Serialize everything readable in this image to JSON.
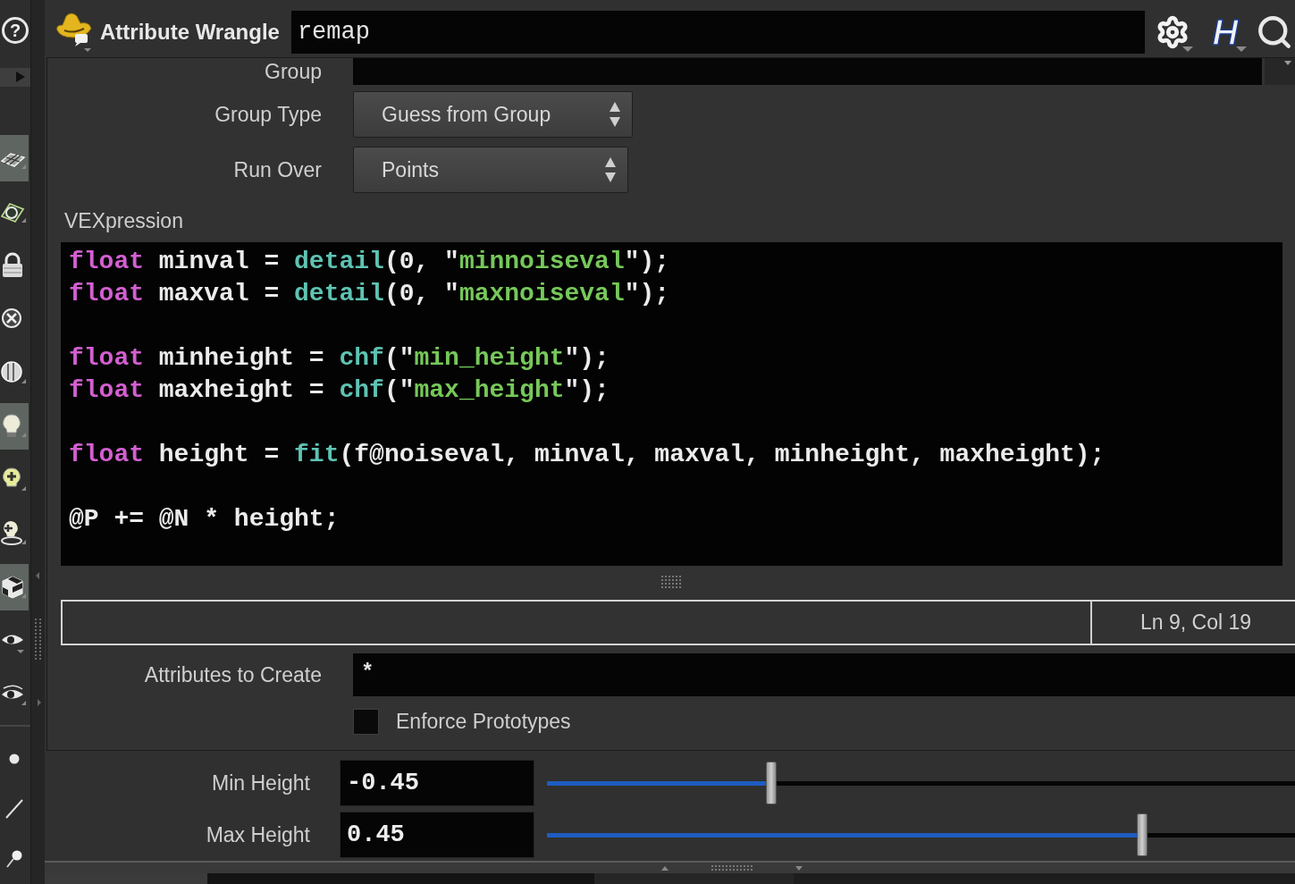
{
  "toolbar": {
    "help": "?",
    "tools": [
      {
        "on": true
      },
      {
        "on": false
      },
      {
        "on": false
      },
      {
        "on": false
      },
      {
        "on": false
      },
      {
        "on": true
      },
      {
        "on": false
      },
      {
        "on": false
      },
      {
        "on": true
      },
      {
        "on": false
      },
      {
        "on": false
      },
      {
        "on": false
      },
      {
        "on": false
      },
      {
        "on": false
      }
    ]
  },
  "header": {
    "node_type": "Attribute Wrangle",
    "node_name": "remap",
    "help_menu": "H"
  },
  "parameters": {
    "group": {
      "label": "Group"
    },
    "group_type": {
      "label": "Group Type",
      "value": "Guess from Group"
    },
    "run_over": {
      "label": "Run Over",
      "value": "Points"
    },
    "vexpression": {
      "label": "VEXpression",
      "lines": [
        {
          "kind": "code",
          "tokens": [
            {
              "kind": "keyword",
              "text": "float"
            },
            {
              "kind": "plain",
              "text": " minval = "
            },
            {
              "kind": "function",
              "text": "detail"
            },
            {
              "kind": "plain",
              "text": "(0, \""
            },
            {
              "kind": "string",
              "text": "minnoiseval"
            },
            {
              "kind": "plain",
              "text": "\");"
            }
          ]
        },
        {
          "kind": "code",
          "tokens": [
            {
              "kind": "keyword",
              "text": "float"
            },
            {
              "kind": "plain",
              "text": " maxval = "
            },
            {
              "kind": "function",
              "text": "detail"
            },
            {
              "kind": "plain",
              "text": "(0, \""
            },
            {
              "kind": "string",
              "text": "maxnoiseval"
            },
            {
              "kind": "plain",
              "text": "\");"
            }
          ]
        },
        {
          "kind": "blank"
        },
        {
          "kind": "code",
          "tokens": [
            {
              "kind": "keyword",
              "text": "float"
            },
            {
              "kind": "plain",
              "text": " minheight = "
            },
            {
              "kind": "function",
              "text": "chf"
            },
            {
              "kind": "plain",
              "text": "(\""
            },
            {
              "kind": "string",
              "text": "min_height"
            },
            {
              "kind": "plain",
              "text": "\");"
            }
          ]
        },
        {
          "kind": "code",
          "tokens": [
            {
              "kind": "keyword",
              "text": "float"
            },
            {
              "kind": "plain",
              "text": " maxheight = "
            },
            {
              "kind": "function",
              "text": "chf"
            },
            {
              "kind": "plain",
              "text": "(\""
            },
            {
              "kind": "string",
              "text": "max_height"
            },
            {
              "kind": "plain",
              "text": "\");"
            }
          ]
        },
        {
          "kind": "blank"
        },
        {
          "kind": "code",
          "tokens": [
            {
              "kind": "keyword",
              "text": "float"
            },
            {
              "kind": "plain",
              "text": " height = "
            },
            {
              "kind": "function",
              "text": "fit"
            },
            {
              "kind": "plain",
              "text": "(f@noiseval, minval, maxval, minheight, maxheight);"
            }
          ]
        },
        {
          "kind": "blank"
        },
        {
          "kind": "code",
          "tokens": [
            {
              "kind": "plain",
              "text": "@P += @N * height;"
            }
          ]
        }
      ],
      "cursor_position": "Ln 9, Col 19"
    },
    "attributes_to_create": {
      "label": "Attributes to Create",
      "value": "*"
    },
    "enforce_prototypes": {
      "label": "Enforce Prototypes",
      "checked": false
    }
  },
  "spare_parameters": [
    {
      "label": "Min Height",
      "value": "-0.45",
      "level": 0.3
    },
    {
      "label": "Max Height",
      "value": "0.45",
      "level": 0.796
    }
  ]
}
